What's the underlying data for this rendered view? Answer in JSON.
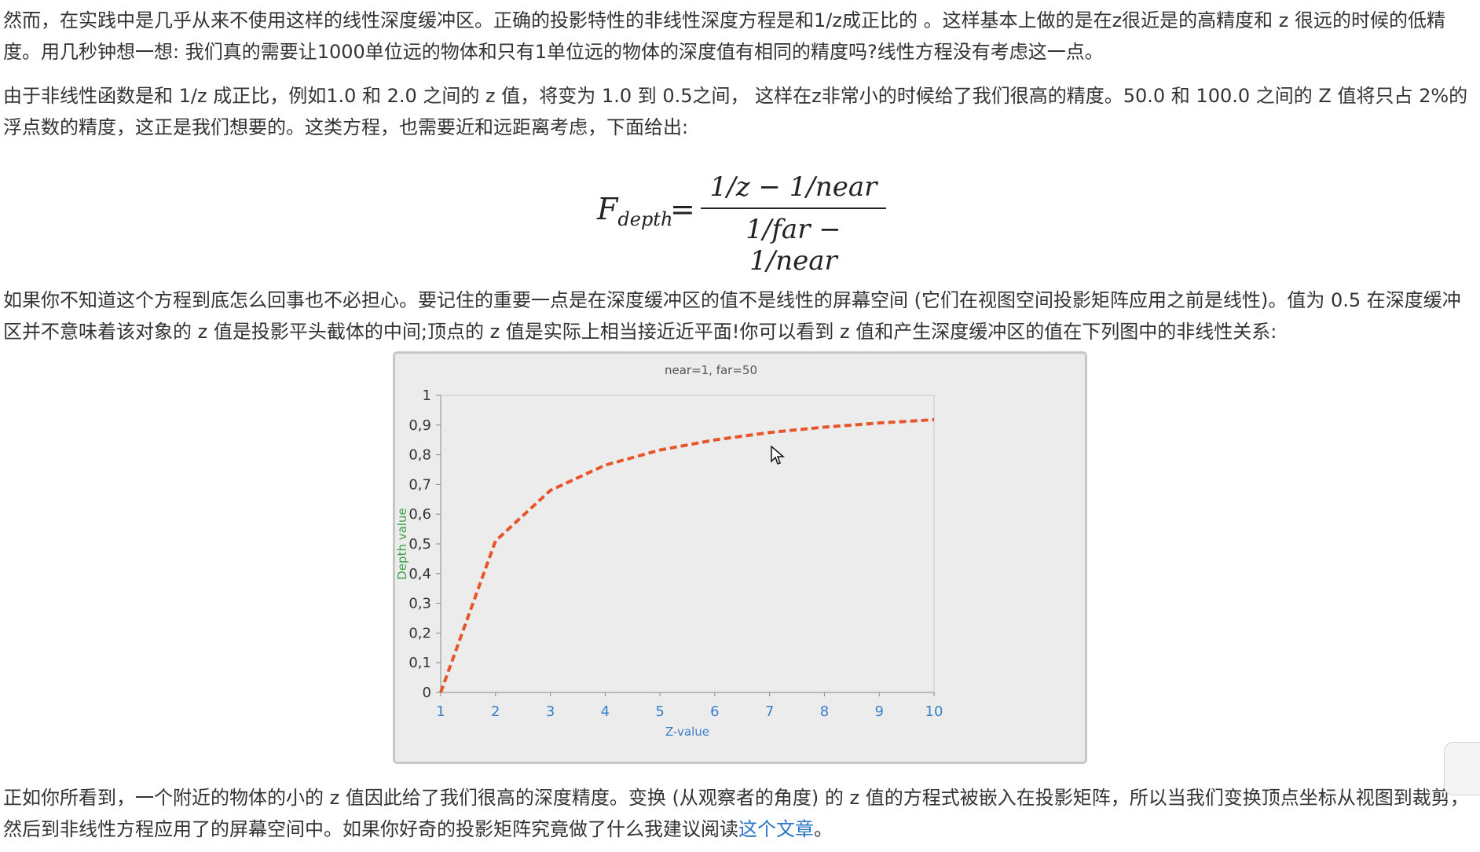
{
  "article": {
    "p1": "然而，在实践中是几乎从来不使用这样的线性深度缓冲区。正确的投影特性的非线性深度方程是和1/z成正比的 。这样基本上做的是在z很近是的高精度和 z 很远的时候的低精度。用几秒钟想一想: 我们真的需要让1000单位远的物体和只有1单位远的物体的深度值有相同的精度吗?线性方程没有考虑这一点。",
    "p2": "由于非线性函数是和 1/z 成正比，例如1.0 和 2.0 之间的 z 值，将变为 1.0 到 0.5之间， 这样在z非常小的时候给了我们很高的精度。50.0 和 100.0 之间的 Z 值将只占 2%的浮点数的精度，这正是我们想要的。这类方程，也需要近和远距离考虑，下面给出:",
    "formula": {
      "lhs": "F",
      "lhs_sub": "depth",
      "equals": "=",
      "numerator": "1/z − 1/near",
      "denominator": "1/far − 1/near"
    },
    "p3": "如果你不知道这个方程到底怎么回事也不必担心。要记住的重要一点是在深度缓冲区的值不是线性的屏幕空间 (它们在视图空间投影矩阵应用之前是线性)。值为 0.5 在深度缓冲区并不意味着该对象的 z 值是投影平头截体的中间;顶点的 z 值是实际上相当接近近平面!你可以看到 z 值和产生深度缓冲区的值在下列图中的非线性关系:",
    "p4_text": "正如你所看到，一个附近的物体的小的 z 值因此给了我们很高的深度精度。变换 (从观察者的角度) 的 z 值的方程式被嵌入在投影矩阵，所以当我们变换顶点坐标从视图到裁剪，然后到非线性方程应用了的屏幕空间中。如果你好奇的投影矩阵究竟做了什么我建议阅读",
    "p4_link": "这个文章",
    "p4_end": "。"
  },
  "chart_data": {
    "type": "line",
    "title": "near=1, far=50",
    "xlabel": "Z-value",
    "ylabel": "Depth value",
    "x": [
      1,
      2,
      3,
      4,
      5,
      6,
      7,
      8,
      9,
      10
    ],
    "series": [
      {
        "values": [
          0,
          0.51,
          0.68,
          0.765,
          0.816,
          0.85,
          0.875,
          0.893,
          0.907,
          0.918
        ]
      }
    ],
    "xlim": [
      1,
      10
    ],
    "ylim": [
      0,
      1
    ],
    "xticks": [
      "1",
      "2",
      "3",
      "4",
      "5",
      "6",
      "7",
      "8",
      "9",
      "10"
    ],
    "yticks": [
      "0",
      "0,1",
      "0,2",
      "0,3",
      "0,4",
      "0,5",
      "0,6",
      "0,7",
      "0,8",
      "0,9",
      "1"
    ],
    "line_color": "#e8552a",
    "line_style": "dashed",
    "grid": false,
    "legend": "none"
  }
}
